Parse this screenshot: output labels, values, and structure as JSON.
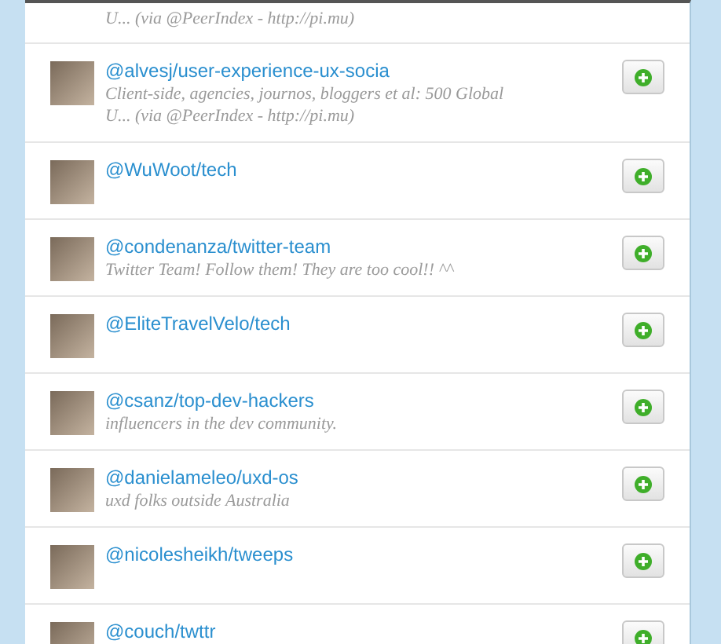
{
  "lists": [
    {
      "kind": "partial",
      "description": "U... (via @PeerIndex - http://pi.mu)"
    },
    {
      "kind": "full",
      "name": "@alvesj/user-experience-ux-socia",
      "description": "Client-side, agencies, journos, bloggers et al: 500 Global U... (via @PeerIndex - http://pi.mu)"
    },
    {
      "kind": "full",
      "name": "@WuWoot/tech"
    },
    {
      "kind": "full",
      "name": "@condenanza/twitter-team",
      "description": "Twitter Team! Follow them! They are too cool!! ^^"
    },
    {
      "kind": "full",
      "name": "@EliteTravelVelo/tech"
    },
    {
      "kind": "full",
      "name": "@csanz/top-dev-hackers",
      "description": "influencers in the dev community."
    },
    {
      "kind": "full",
      "name": "@danielameleo/uxd-os",
      "description": "uxd folks outside Australia"
    },
    {
      "kind": "full",
      "name": "@nicolesheikh/tweeps"
    },
    {
      "kind": "full",
      "name": "@couch/twttr"
    }
  ]
}
